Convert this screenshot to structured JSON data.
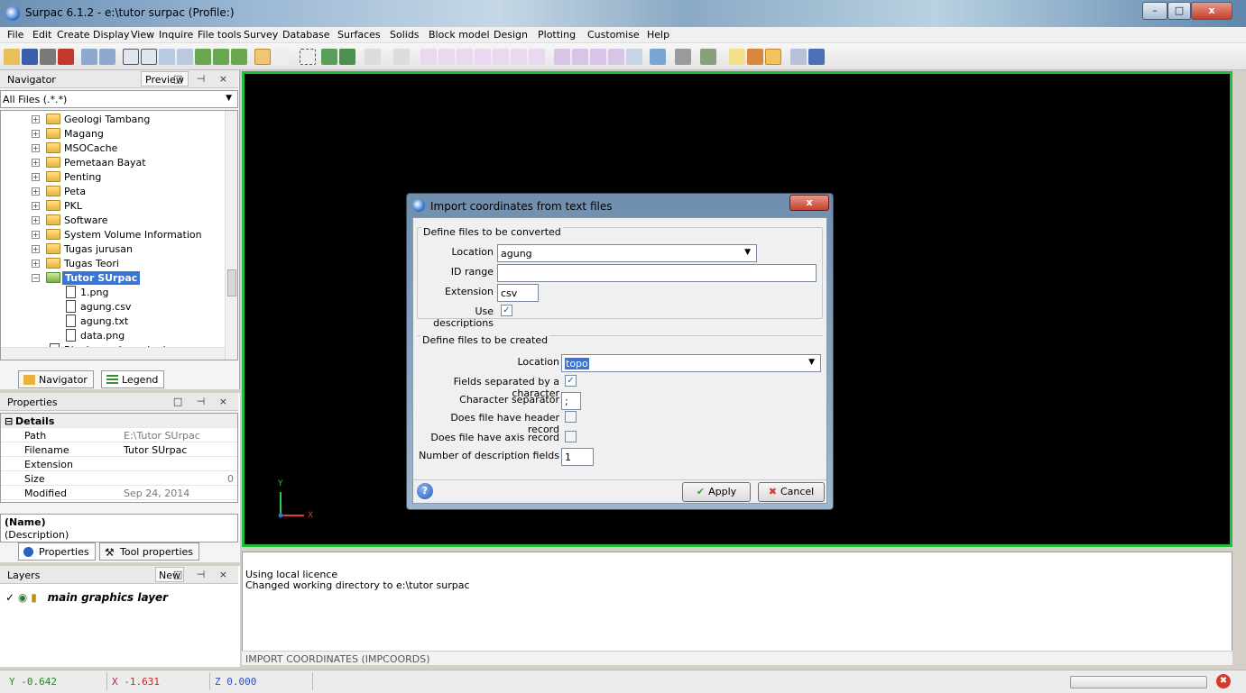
{
  "window": {
    "title": "Surpac 6.1.2 - e:\\tutor surpac (Profile:)",
    "min": "–",
    "max": "□",
    "close": "x"
  },
  "menu": [
    "File",
    "Edit",
    "Create",
    "Display",
    "View",
    "Inquire",
    "File tools",
    "Survey",
    "Database",
    "Surfaces",
    "Solids",
    "Block model",
    "Design",
    "Plotting",
    "Customise",
    "Help"
  ],
  "navigator": {
    "title": "Navigator",
    "preview": "Preview",
    "controls": "□ ⊣ ×",
    "filter": "All Files (.*.*)",
    "tree": [
      {
        "label": "Geologi Tambang",
        "type": "folder"
      },
      {
        "label": "Magang",
        "type": "folder"
      },
      {
        "label": "MSOCache",
        "type": "folder"
      },
      {
        "label": "Pemetaan Bayat",
        "type": "folder"
      },
      {
        "label": "Penting",
        "type": "folder"
      },
      {
        "label": "Peta",
        "type": "folder"
      },
      {
        "label": "PKL",
        "type": "folder"
      },
      {
        "label": "Software",
        "type": "folder"
      },
      {
        "label": "System Volume Information",
        "type": "folder"
      },
      {
        "label": "Tugas jurusan",
        "type": "folder"
      },
      {
        "label": "Tugas Teori",
        "type": "folder"
      },
      {
        "label": "Tutor SUrpac",
        "type": "folder-open"
      },
      {
        "label": "1.png",
        "type": "file"
      },
      {
        "label": "agung.csv",
        "type": "file"
      },
      {
        "label": "agung.txt",
        "type": "file"
      },
      {
        "label": "data.png",
        "type": "file"
      },
      {
        "label": "Ringkasan Jamrek .docx",
        "type": "file"
      }
    ],
    "tabs": [
      "Navigator",
      "Legend"
    ]
  },
  "properties": {
    "title": "Properties",
    "controls": "□ ⊣ ×",
    "section": "Details",
    "rows": [
      {
        "k": "Path",
        "v": "E:\\Tutor SUrpac"
      },
      {
        "k": "Filename",
        "v": "Tutor SUrpac"
      },
      {
        "k": "Extension",
        "v": ""
      },
      {
        "k": "Size",
        "v": "0"
      },
      {
        "k": "Modified",
        "v": "Sep 24, 2014"
      }
    ],
    "name": "(Name)",
    "description": "(Description)",
    "tabs": [
      "Properties",
      "Tool properties"
    ]
  },
  "layers": {
    "title": "Layers",
    "new": "New",
    "controls": "□ ⊣ ×",
    "item": "main graphics layer"
  },
  "viewport": {
    "axis_y": "Y",
    "axis_x": "X",
    "axis_z": "Z"
  },
  "dialog": {
    "title": "Import coordinates from text files",
    "group1": "Define files to be converted",
    "location_label": "Location",
    "location_value": "agung",
    "idrange_label": "ID range",
    "idrange_value": "",
    "ext_label": "Extension",
    "ext_value": "csv",
    "usedesc_label": "Use descriptions",
    "group2": "Define files to be created",
    "location2_label": "Location",
    "location2_value": "topo",
    "sepchar_label": "Fields separated by a character",
    "charsep_label": "Character separator",
    "charsep_value": ";",
    "header_label": "Does file have header record",
    "axis_label": "Does file have axis record",
    "ndesc_label": "Number of description fields",
    "ndesc_value": "1",
    "apply": "Apply",
    "cancel": "Cancel",
    "help": "?"
  },
  "console": {
    "lines": [
      "Using local licence",
      "Changed working directory to e:\\tutor surpac"
    ],
    "command": "IMPORT COORDINATES (IMPCOORDS)"
  },
  "status": {
    "y": "Y -0.642",
    "x": "X -1.631",
    "z": "Z 0.000"
  },
  "colors": {
    "viewport_border": "#1fbf3a",
    "selection": "#3875d7"
  }
}
